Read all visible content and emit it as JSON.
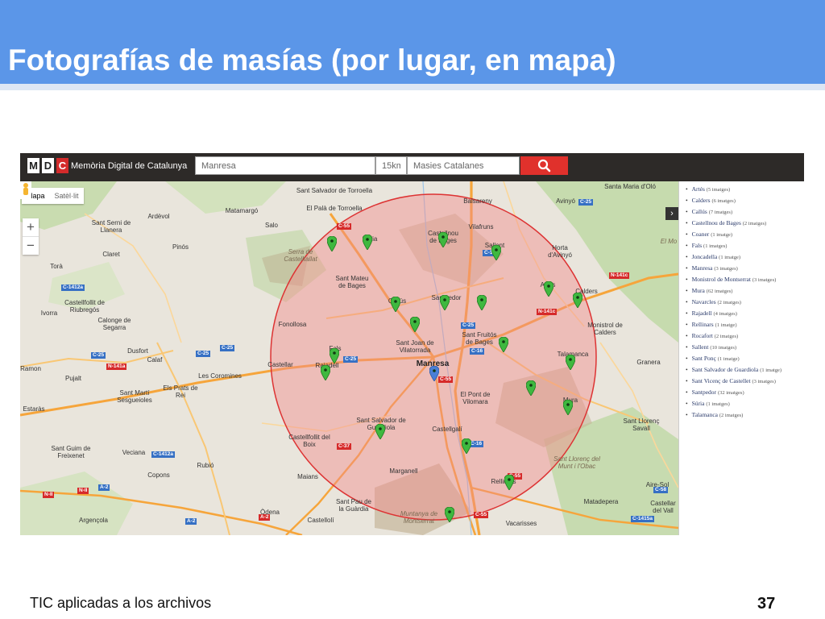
{
  "slide": {
    "title": "Fotografías de masías (por lugar, en mapa)",
    "footer": "TIC aplicadas a los archivos",
    "page_number": "37",
    "header_color": "#5b96e8"
  },
  "app": {
    "logo_letters": [
      "M",
      "D",
      "C"
    ],
    "name": "Memòria Digital de Catalunya",
    "search_place": "Manresa",
    "radius": "15km",
    "collection": "Masies Catalanes",
    "search_icon": "search-icon",
    "accent_color": "#e0312c"
  },
  "map_controls": {
    "map_label": "Mapa",
    "satellite_label": "Satèl·lit",
    "zoom_in": "+",
    "zoom_out": "−",
    "toggle": "›"
  },
  "legend": [
    {
      "name": "Artés",
      "count": "(5 imatges)"
    },
    {
      "name": "Calders",
      "count": "(6 imatges)"
    },
    {
      "name": "Callús",
      "count": "(7 imatges)"
    },
    {
      "name": "Castellnou de Bages",
      "count": "(2 imatges)"
    },
    {
      "name": "Coaner",
      "count": "(1 imatge)"
    },
    {
      "name": "Fals",
      "count": "(1 imatges)"
    },
    {
      "name": "Joncadella",
      "count": "(1 imatge)"
    },
    {
      "name": "Manresa",
      "count": "(3 imatges)"
    },
    {
      "name": "Monistrol de Montserrat",
      "count": "(3 imatges)"
    },
    {
      "name": "Mura",
      "count": "(62 imatges)"
    },
    {
      "name": "Navarcles",
      "count": "(2 imatges)"
    },
    {
      "name": "Rajadell",
      "count": "(4 imatges)"
    },
    {
      "name": "Rellinars",
      "count": "(1 imatge)"
    },
    {
      "name": "Rocafort",
      "count": "(2 imatges)"
    },
    {
      "name": "Sallent",
      "count": "(10 imatges)"
    },
    {
      "name": "Sant Ponç",
      "count": "(1 imatge)"
    },
    {
      "name": "Sant Salvador de Guardiola",
      "count": "(1 imatge)"
    },
    {
      "name": "Sant Vicenç de Castellet",
      "count": "(3 imatges)"
    },
    {
      "name": "Santpedor",
      "count": "(32 imatges)"
    },
    {
      "name": "Súria",
      "count": "(1 imatges)"
    },
    {
      "name": "Talamanca",
      "count": "(2 imatges)"
    }
  ],
  "map_places": [
    "Sant Salvador de Torroella",
    "El Palà de Torroella",
    "Balsareny",
    "Avinyó",
    "Santa Maria d'Oló",
    "Matamargó",
    "Salo",
    "Súria",
    "Castellnou de Bages",
    "Vilafruns",
    "Sallent",
    "Horta d'Avinyó",
    "El Mo",
    "Sant Serni de Llanera",
    "Ardèvol",
    "Pinós",
    "Claret",
    "Torà",
    "Sant Mateu de Bages",
    "Callús",
    "Santpedor",
    "Artés",
    "Calders",
    "Castellfollit de Riubregós",
    "Ivorra",
    "Calonge de Segarra",
    "Fonollosa",
    "Sant Fruitós de Bages",
    "Monistrol de Calders",
    "Fals",
    "Sant Joan de Vilatorrada",
    "Manresa",
    "Talamanca",
    "Granera",
    "Dusfort",
    "Calaf",
    "Ramon",
    "Castellar",
    "Rajadell",
    "Pujalt",
    "Els Prats de Rei",
    "Les Coromines",
    "Sant Martí Sesgueioles",
    "El Pont de Vilomara",
    "Estaràs",
    "Sant Salvador de Guardiola",
    "Mura",
    "Sant Llorenç Savall",
    "Castellfollit del Boix",
    "Castellgalí",
    "Sant Guim de Freixenet",
    "Veciana",
    "Rubió",
    "Sant Llorenç del Munt i l'Obac",
    "Copons",
    "Maians",
    "Marganell",
    "Rellinars",
    "Aire-Sol",
    "Castellar del Vall",
    "Argençola",
    "Òdena",
    "Castellolí",
    "Sant Pau de la Guàrdia",
    "Muntanya de Montserrat",
    "Matadepera",
    "Vacarisses",
    "Serra de Castelltallat"
  ],
  "road_labels": [
    "C-55",
    "C-25",
    "C-16",
    "C-37",
    "N-141c",
    "N-141a",
    "C-1412a",
    "A-2",
    "N-II",
    "C-1415a",
    "C-58"
  ],
  "markers": [
    "green-pin",
    "blue-pin"
  ]
}
